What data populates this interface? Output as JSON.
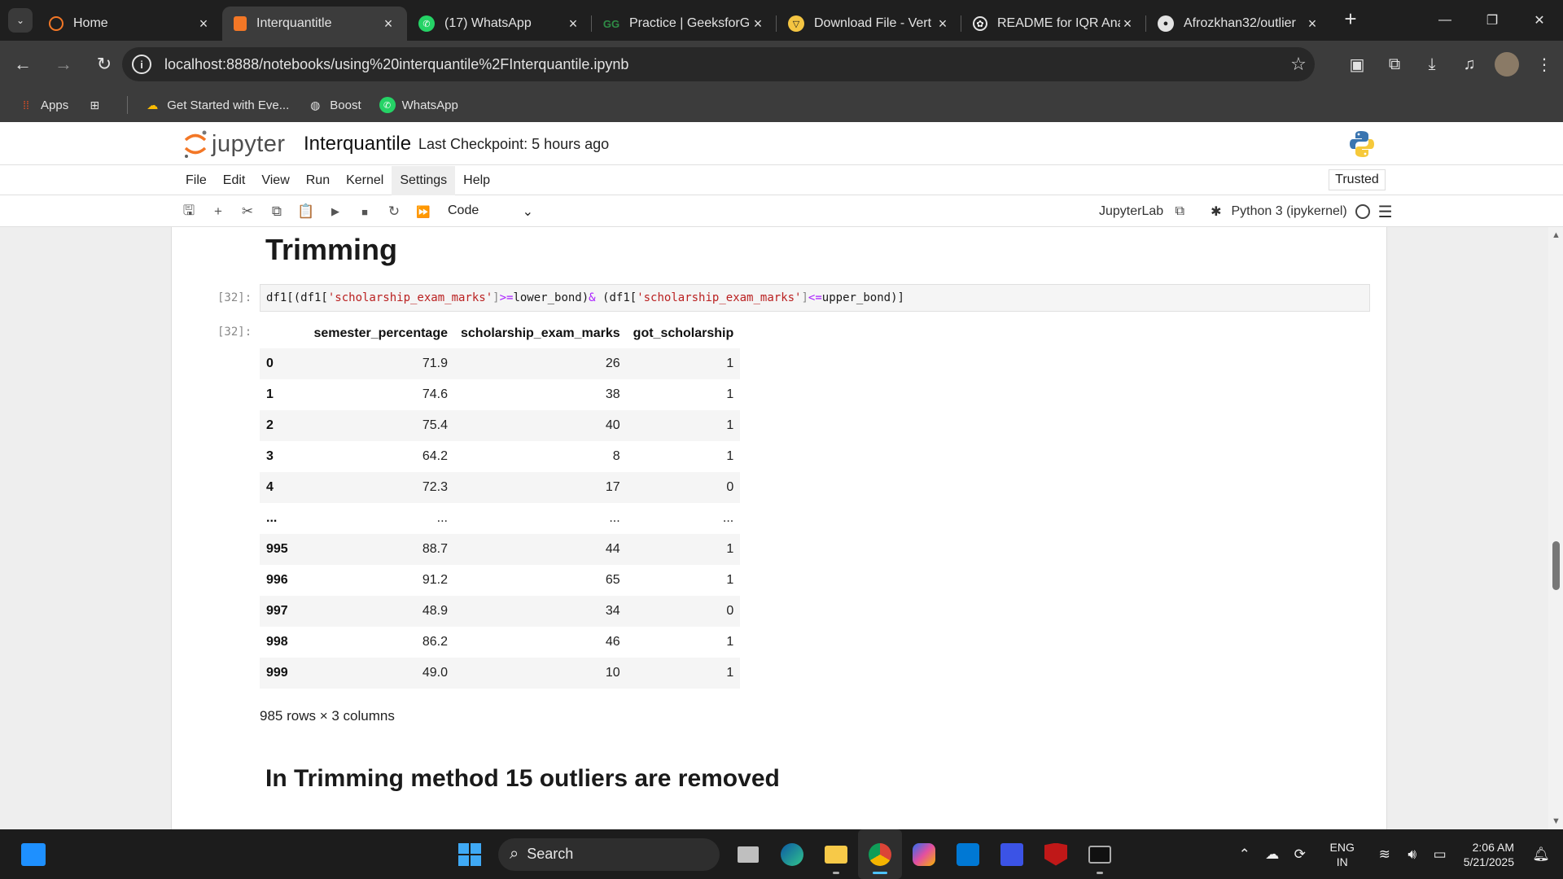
{
  "browser": {
    "tabs": [
      {
        "label": "Home",
        "icon": "jupyter-icon"
      },
      {
        "label": "Interquantitle",
        "icon": "jupyter-notebook-icon",
        "active": true
      },
      {
        "label": "(17) WhatsApp",
        "icon": "whatsapp-icon"
      },
      {
        "label": "Practice | GeeksforGe",
        "icon": "geeksforgeeks-icon"
      },
      {
        "label": "Download File - Vert",
        "icon": "vertex-icon"
      },
      {
        "label": "README for IQR Ana",
        "icon": "chatgpt-icon"
      },
      {
        "label": "Afrozkhan32/outlier",
        "icon": "github-icon"
      }
    ],
    "url": "localhost:8888/notebooks/using%20interquantile%2FInterquantile.ipynb",
    "bookmarks": [
      {
        "label": "Apps"
      },
      {
        "label": "Get Started with Eve..."
      },
      {
        "label": "Boost"
      },
      {
        "label": "WhatsApp"
      }
    ]
  },
  "jupyter": {
    "logo_text": "jupyter",
    "notebook_title": "Interquantile",
    "checkpoint": "Last Checkpoint: 5 hours ago",
    "menu": [
      "File",
      "Edit",
      "View",
      "Run",
      "Kernel",
      "Settings",
      "Help"
    ],
    "trusted": "Trusted",
    "cell_type": "Code",
    "jupyterlab_label": "JupyterLab",
    "kernel_name": "Python 3 (ipykernel)"
  },
  "notebook": {
    "heading_trimming": "Trimming",
    "in_prompt": "[32]:",
    "out_prompt": "[32]:",
    "code": {
      "p1": "df1[(df1[",
      "s1": "'scholarship_exam_marks'",
      "p2": "]",
      "o1": ">=",
      "p3": "lower_bond)",
      "o2": "&",
      "p4": " (df1[",
      "s2": "'scholarship_exam_marks'",
      "p5": "]",
      "o3": "<=",
      "p6": "upper_bond)]"
    },
    "dataframe": {
      "columns": [
        "semester_percentage",
        "scholarship_exam_marks",
        "got_scholarship"
      ],
      "rows": [
        {
          "index": "0",
          "values": [
            "71.9",
            "26",
            "1"
          ]
        },
        {
          "index": "1",
          "values": [
            "74.6",
            "38",
            "1"
          ]
        },
        {
          "index": "2",
          "values": [
            "75.4",
            "40",
            "1"
          ]
        },
        {
          "index": "3",
          "values": [
            "64.2",
            "8",
            "1"
          ]
        },
        {
          "index": "4",
          "values": [
            "72.3",
            "17",
            "0"
          ]
        },
        {
          "index": "...",
          "values": [
            "...",
            "...",
            "..."
          ]
        },
        {
          "index": "995",
          "values": [
            "88.7",
            "44",
            "1"
          ]
        },
        {
          "index": "996",
          "values": [
            "91.2",
            "65",
            "1"
          ]
        },
        {
          "index": "997",
          "values": [
            "48.9",
            "34",
            "0"
          ]
        },
        {
          "index": "998",
          "values": [
            "86.2",
            "46",
            "1"
          ]
        },
        {
          "index": "999",
          "values": [
            "49.0",
            "10",
            "1"
          ]
        }
      ],
      "shape_text": "985 rows × 3 columns"
    },
    "heading_outliers": "In Trimming method 15 outliers are removed"
  },
  "taskbar": {
    "search_label": "Search",
    "language": "ENG",
    "region": "IN",
    "time": "2:06 AM",
    "date": "5/21/2025"
  },
  "colors": {
    "chrome_dark": "#1f1f1f",
    "chrome_toolbar": "#3c3c3c",
    "jupyter_orange": "#f37726",
    "taskbar": "#1c1c1c"
  }
}
